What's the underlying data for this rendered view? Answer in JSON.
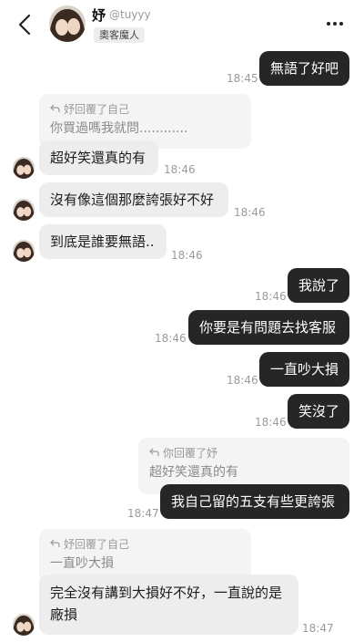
{
  "header": {
    "name": "妤",
    "handle": "@tuyyy",
    "badge": "奧客魔人"
  },
  "messages": [
    {
      "text": "無語了好吧",
      "time": "18:45"
    },
    {
      "reply_label": "妤回覆了自己",
      "reply_quote": "你買過嗎我就問............",
      "text": "超好笑還真的有",
      "time": "18:46"
    },
    {
      "text": "沒有像這個那麼誇張好不好",
      "time": "18:46"
    },
    {
      "text": "到底是誰要無語..",
      "time": "18:46"
    },
    {
      "text": "我說了",
      "time": "18:46"
    },
    {
      "text": "你要是有問題去找客服",
      "time": "18:46"
    },
    {
      "text": "一直吵大損",
      "time": "18:46"
    },
    {
      "text": "笑沒了",
      "time": "18:46"
    },
    {
      "reply_label": "你回覆了妤",
      "reply_quote": "超好笑還真的有",
      "text": "我自己留的五支有些更誇張",
      "time": "18:47"
    },
    {
      "reply_label": "妤回覆了自己",
      "reply_quote": "一直吵大損",
      "text": "完全沒有講到大損好不好，一直說的是廠損",
      "time": "18:47"
    }
  ]
}
